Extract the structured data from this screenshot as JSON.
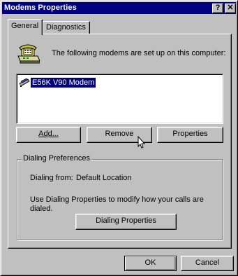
{
  "window": {
    "title": "Modems Properties",
    "help_glyph": "?",
    "close_glyph": "✕"
  },
  "tabs": [
    {
      "label": "General",
      "active": true
    },
    {
      "label": "Diagnostics",
      "active": false
    }
  ],
  "general": {
    "intro": "The following modems are set up on this computer:",
    "modems": [
      {
        "name": "E56K V90 Modem",
        "selected": true
      }
    ],
    "buttons": {
      "add": "Add...",
      "remove": "Remove",
      "properties": "Properties"
    },
    "dialing": {
      "group_title": "Dialing Preferences",
      "from_label": "Dialing from:",
      "from_value": "Default Location",
      "info_line1": "Use Dialing Properties to modify how your calls are",
      "info_line2": "dialed.",
      "button": "Dialing Properties"
    }
  },
  "footer": {
    "ok": "OK",
    "cancel": "Cancel"
  },
  "colors": {
    "face": "#c0c0c0",
    "titlebar": "#000080",
    "selection": "#000080"
  },
  "icons": {
    "modem": "telephone-modem-icon",
    "list_modem": "modem-device-icon",
    "cursor": "arrow-cursor-icon"
  }
}
